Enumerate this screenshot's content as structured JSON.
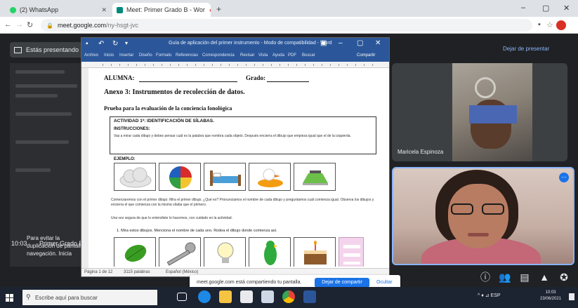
{
  "browser": {
    "tabs": [
      {
        "label": "(2) WhatsApp",
        "fav_color": "#25d366"
      },
      {
        "label": "Meet: Primer Grado B - Wor",
        "fav_color": "#00897b"
      }
    ],
    "new_tab": "+",
    "url_host": "meet.google.com",
    "url_path": "/ny-hsgt-jvc",
    "window_controls": {
      "minimize": "–",
      "maximize": "▢",
      "close": "✕"
    }
  },
  "meet": {
    "presenting_label": "Estás presentando",
    "stop_presenting": "Dejar de presentar",
    "side_text": "Para evitar la duplicación de pantalla, navegación. Inicia",
    "time": "10:03",
    "meeting_title": "Primer Grado B",
    "tile1_name": "Maricela Espinoza",
    "controls": [
      "info-icon",
      "people-icon",
      "chat-icon",
      "activities-icon",
      "shield-icon"
    ]
  },
  "word": {
    "doc_title": "Guía de aplicación del primer instrumento - Modo de compatibilidad - Word",
    "ribbon": [
      "Archivo",
      "Inicio",
      "Insertar",
      "Diseño",
      "Formato",
      "Referencias",
      "Correspondencia",
      "Revisar",
      "Vista",
      "Ayuda",
      "PDF",
      "Buscar"
    ],
    "share": "Compartir",
    "status": {
      "page": "Página 1 de 12",
      "words": "3115 palabras",
      "lang": "Español (México)"
    },
    "page": {
      "alumna": "ALUMNA:",
      "grado": "Grado:",
      "annex": "Anexo 3: Instrumentos de recolección de datos.",
      "test_title": "Prueba para la evaluación de la conciencia fonológica",
      "activity": "ACTIVIDAD 1ª: IDENTIFICACIÓN DE SÍLABAS.",
      "instructions_label": "INSTRUCCIONES:",
      "instructions_text": "Vas a mirar cada dibujo y debes pensar cuál es la palabra que nombra cada objeto. Después encierra el dibujo que empieza igual que el de la izquierda.",
      "example_label": "EJEMPLO:",
      "paragraph1": "Comenzaremos con el primer dibujo: Mira el primer dibujo. ¿Qué es? Pronunciamos el nombre de cada dibujo y preguntamos cuál comienza igual. Observa los dibujos y encierra el que comienza con la misma sílaba que el primero.",
      "paragraph2": "Una vez segura de que lo entendiste lo hacemos, con cuidado en la actividad.",
      "question": "1.  Mira estos dibujos. Menciona el nombre de cada uno. Rodea el dibujo donde comienza así."
    }
  },
  "notification": {
    "message": "meet.google.com está compartiendo tu pantalla.",
    "button": "Dejar de compartir",
    "hide": "Ocultar"
  },
  "taskbar": {
    "search_placeholder": "Escribe aquí para buscar",
    "apps": [
      "task-view",
      "edge",
      "file-explorer",
      "store",
      "mail",
      "chrome",
      "word"
    ],
    "tray": "^  ♦  ⊿  ESP",
    "clock_time": "10:03",
    "clock_date": "23/06/2021"
  },
  "colors": {
    "word_blue": "#2b579a",
    "meet_bg": "#202124",
    "taskbar_bg": "#1c2331",
    "accent_blue": "#1a73e8"
  }
}
